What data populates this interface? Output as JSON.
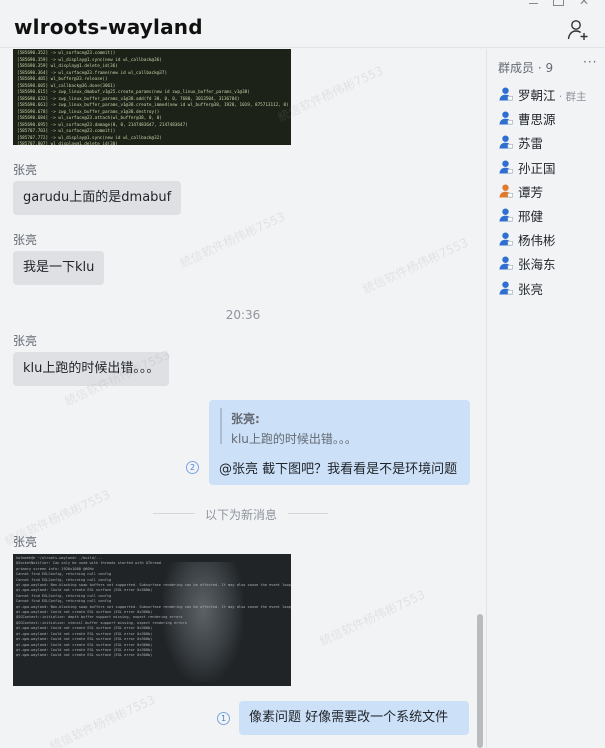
{
  "window": {
    "title": "wlroots-wayland",
    "controls": [
      "minimize-icon",
      "maximize-icon",
      "close-icon"
    ],
    "add_member_icon": "add-person-icon"
  },
  "chat": {
    "messages": [
      {
        "sender": "张亮",
        "text": "garudu上面的是dmabuf"
      },
      {
        "sender": "张亮",
        "text": "我是一下klu"
      },
      {
        "sender": "张亮",
        "text": "klu上跑的时候出错。。。"
      }
    ],
    "time_separator": "20:36",
    "reply_message": {
      "quoted_sender": "张亮:",
      "quoted_text": "klu上跑的时候出错。。。",
      "text": "@张亮  截下图吧？我看看是不是环境问题",
      "unread_count": "2"
    },
    "new_messages_divider": "以下为新消息",
    "image_sender": "张亮",
    "last_message": {
      "text": "像素问题    好像需要改一个系统文件",
      "unread_count": "1"
    },
    "terminal_log_top": [
      "[585690.352] -> wl_surface@23.commit()",
      "[585690.359] -> wl_display@1.sync(new id wl_callback@36)",
      "[585690.359] wl_display@1.delete_id(36)",
      "[585690.364] -> wl_surface@23.frame(new id wl_callback@37)",
      "[585690.405] wl_buffer@33.release()",
      "[585690.605] wl_callback@36.done(3061)",
      "[585690.615] -> zwp_linux_dmabuf_v1@25.create_params(new id zwp_linux_buffer_params_v1@38)",
      "[585690.632] -> zwp_linux_buffer_params_v1@38.add(fd 30, 0, 0, 7680, 3013504, 3136784)",
      "[585690.661] -> zwp_linux_buffer_params_v1@38.create_immed(new id wl_buffer@38, 1920, 1019, 875713112, 0)",
      "[585690.678] -> zwp_linux_buffer_params_v1@38.destroy()",
      "[585690.684] -> wl_surface@23.attach(wl_buffer@38, 0, 0)",
      "[585690.695] -> wl_surface@23.damage(0, 0, 2147483647, 2147483647)",
      "[585707.703] -> wl_surface@23.commit()",
      "[585707.772] -> wl_display@1.sync(new id wl_callback@32)",
      "[585707.807] wl_display@1.delete_id(30)",
      "[585707.897] wl_display@1.delete_id(32)"
    ],
    "terminal_log_bottom": [
      "kwlmeeh@k ~/wlroots-wayland> ./build/...",
      "QSocketNotifier: Can only be used with threads started with QThread",
      "primary screen info: 1920x1080 @60Hz",
      "Cannot find EGLConfig, returning null config",
      "Cannot find EGLConfig, returning null config",
      "qt.qpa.wayland: Non-blocking swap buffers not supported. Subsurface rendering can be affected. It may also cause the event loop to freeze in some situations",
      "qt.qpa.wayland: Could not create EGL surface (EGL error 0x300b)",
      "Cannot find EGLConfig, returning null config",
      "Cannot find EGLConfig, returning null config",
      "qt.qpa.wayland: Non-blocking swap buffers not supported. Subsurface rendering can be affected. It may also cause the event loop to freeze in some situations",
      "qt.qpa.wayland: Could not create EGL surface (EGL error 0x300b)",
      "QSGContext::initialize: depth buffer support missing, expect rendering errors",
      "QSGContext::initialize: stencil buffer support missing, expect rendering errors",
      "qt.qpa.wayland: Could not create EGL surface (EGL error 0x300b)",
      "qt.qpa.wayland: Could not create EGL surface (EGL error 0x300b)",
      "qt.qpa.wayland: Could not create EGL surface (EGL error 0x300b)",
      "qt.qpa.wayland: Could not create EGL surface (EGL error 0x300b)",
      "qt.qpa.wayland: Could not create EGL surface (EGL error 0x300b)",
      "qt.qpa.wayland: Could not create EGL surface (EGL error 0x300b)"
    ],
    "watermark": "統信软件杨伟彬7553"
  },
  "sidebar": {
    "title": "群成员 · 9",
    "more_label": "···",
    "members": [
      {
        "name": "罗朝江",
        "role": "· 群主",
        "avatar_color": "#2f6fd1"
      },
      {
        "name": "曹思源",
        "role": "",
        "avatar_color": "#2f6fd1"
      },
      {
        "name": "苏雷",
        "role": "",
        "avatar_color": "#2f6fd1"
      },
      {
        "name": "孙正国",
        "role": "",
        "avatar_color": "#2f6fd1"
      },
      {
        "name": "谭芳",
        "role": "",
        "avatar_color": "#e07b2e"
      },
      {
        "name": "邢健",
        "role": "",
        "avatar_color": "#2f6fd1"
      },
      {
        "name": "杨伟彬",
        "role": "",
        "avatar_color": "#2f6fd1"
      },
      {
        "name": "张海东",
        "role": "",
        "avatar_color": "#2f6fd1"
      },
      {
        "name": "张亮",
        "role": "",
        "avatar_color": "#2f6fd1"
      }
    ]
  }
}
